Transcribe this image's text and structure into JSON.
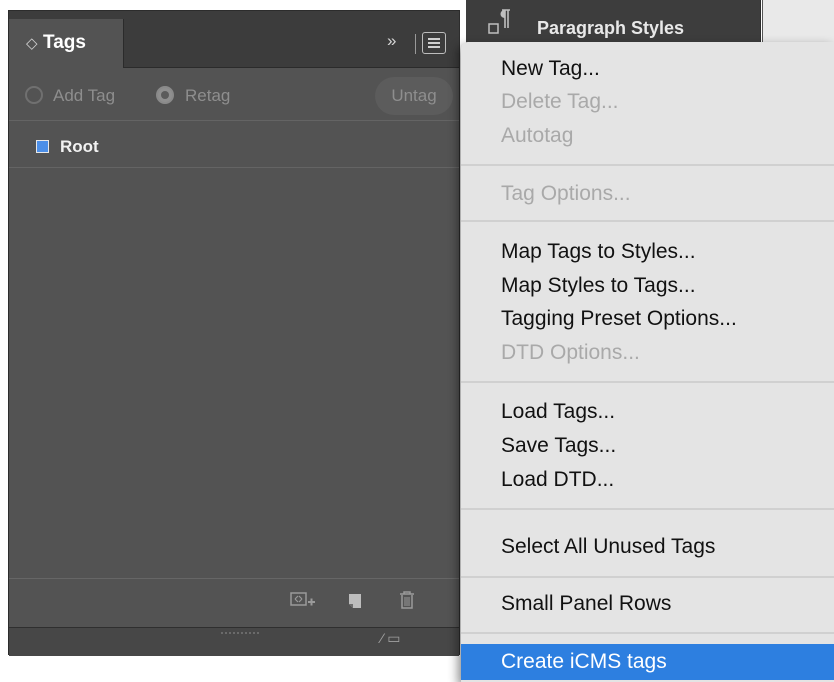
{
  "tags_panel": {
    "tab_title": "Tags",
    "tab_arrows": "◇",
    "collapse_glyph": "»",
    "add_tag_label": "Add Tag",
    "retag_label": "Retag",
    "untag_label": "Untag",
    "mode_selected": "Retag",
    "tags": [
      {
        "name": "Root",
        "color": "#4c8fe8"
      }
    ],
    "bottom_icons": [
      "new-tag-from-style-icon",
      "new-tag-icon",
      "trash-icon"
    ]
  },
  "paragraph_styles": {
    "title": "Paragraph Styles",
    "icon": "paragraph-icon"
  },
  "menu": {
    "items": [
      {
        "label": "New Tag...",
        "enabled": true
      },
      {
        "label": "Delete Tag...",
        "enabled": false
      },
      {
        "label": "Autotag",
        "enabled": false
      },
      {
        "label": "Tag Options...",
        "enabled": false
      },
      {
        "label": "Map Tags to Styles...",
        "enabled": true
      },
      {
        "label": "Map Styles to Tags...",
        "enabled": true
      },
      {
        "label": "Tagging Preset Options...",
        "enabled": true
      },
      {
        "label": "DTD Options...",
        "enabled": false
      },
      {
        "label": "Load Tags...",
        "enabled": true
      },
      {
        "label": "Save Tags...",
        "enabled": true
      },
      {
        "label": "Load DTD...",
        "enabled": true
      },
      {
        "label": "Select All Unused Tags",
        "enabled": true
      },
      {
        "label": "Small Panel Rows",
        "enabled": true
      },
      {
        "label": "Create iCMS tags",
        "enabled": true,
        "highlighted": true
      }
    ]
  },
  "colors": {
    "panel_bg": "#535353",
    "menu_bg": "#e4e4e4",
    "menu_highlight": "#2d7fe0",
    "disabled_text": "#a9a9a9"
  }
}
